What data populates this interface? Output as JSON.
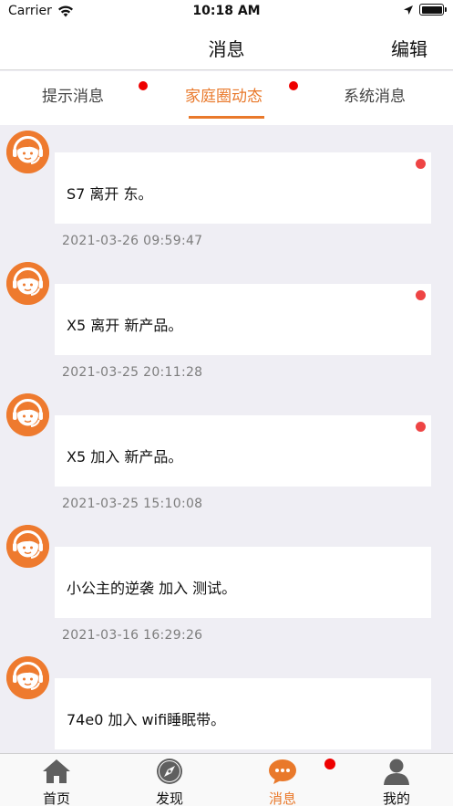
{
  "status_bar": {
    "carrier": "Carrier",
    "time": "10:18 AM",
    "icons": [
      "wifi-icon",
      "location-arrow-icon",
      "battery-icon"
    ]
  },
  "nav": {
    "title": "消息",
    "edit_label": "编辑"
  },
  "tabs": [
    {
      "label": "提示消息",
      "active": false,
      "has_dot": true
    },
    {
      "label": "家庭圈动态",
      "active": true,
      "has_dot": true
    },
    {
      "label": "系统消息",
      "active": false,
      "has_dot": false
    }
  ],
  "feed": [
    {
      "text": "S7 离开 东。",
      "time": "2021-03-26 09:59:47",
      "unread": true
    },
    {
      "text": "X5 离开 新产品。",
      "time": "2021-03-25 20:11:28",
      "unread": true
    },
    {
      "text": "X5 加入 新产品。",
      "time": "2021-03-25 15:10:08",
      "unread": true
    },
    {
      "text": "小公主的逆袭 加入 测试。",
      "time": "2021-03-16 16:29:26",
      "unread": false
    },
    {
      "text": "74e0 加入 wifi睡眠带。",
      "time": "",
      "unread": false
    }
  ],
  "tabbar": [
    {
      "label": "首页",
      "icon": "home-icon",
      "active": false
    },
    {
      "label": "发现",
      "icon": "compass-icon",
      "active": false
    },
    {
      "label": "消息",
      "icon": "chat-bubble-icon",
      "active": true,
      "has_dot": true
    },
    {
      "label": "我的",
      "icon": "person-icon",
      "active": false
    }
  ],
  "colors": {
    "accent": "#e9792b",
    "badge": "#ee0000",
    "unread_dot": "#ee4444",
    "background": "#efeef4"
  }
}
